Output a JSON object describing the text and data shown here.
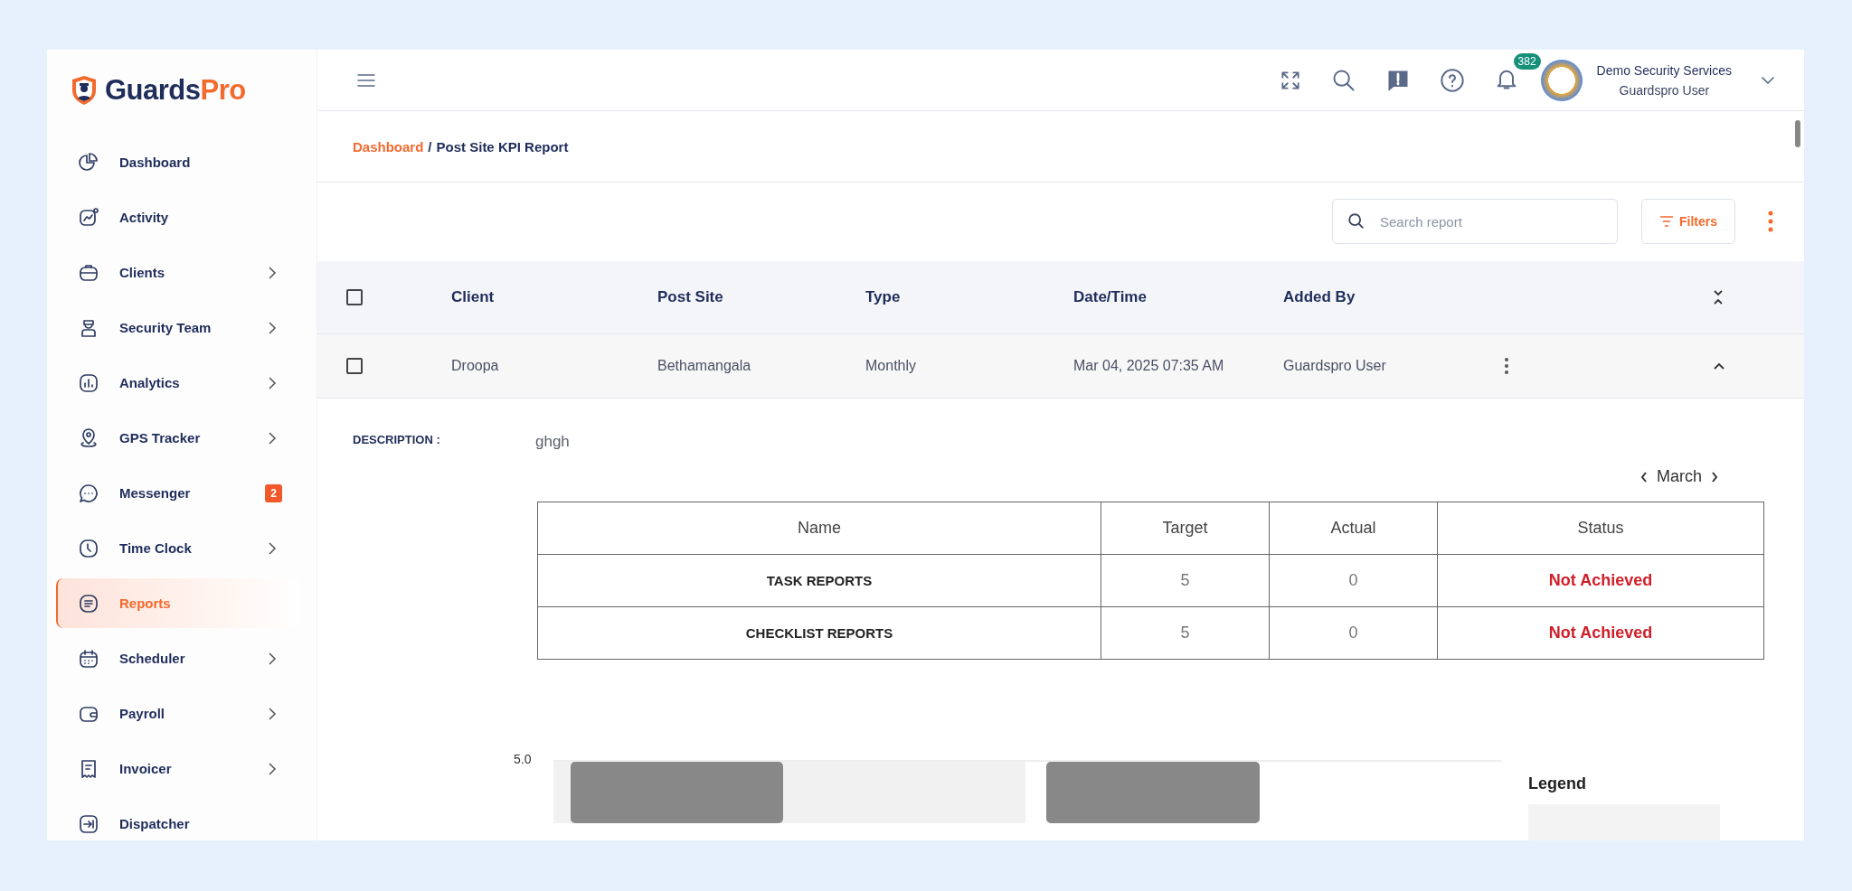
{
  "logo": {
    "text": "Guards",
    "accent_text": "Pro"
  },
  "sidebar": {
    "items": [
      {
        "label": "Dashboard",
        "selected": false,
        "has_submenu": false
      },
      {
        "label": "Activity",
        "selected": false,
        "has_submenu": false
      },
      {
        "label": "Clients",
        "selected": false,
        "has_submenu": true
      },
      {
        "label": "Security Team",
        "selected": false,
        "has_submenu": true
      },
      {
        "label": "Analytics",
        "selected": false,
        "has_submenu": true
      },
      {
        "label": "GPS Tracker",
        "selected": false,
        "has_submenu": true
      },
      {
        "label": "Messenger",
        "selected": false,
        "has_submenu": false,
        "badge": "2"
      },
      {
        "label": "Time Clock",
        "selected": false,
        "has_submenu": true
      },
      {
        "label": "Reports",
        "selected": true,
        "has_submenu": false
      },
      {
        "label": "Scheduler",
        "selected": false,
        "has_submenu": true
      },
      {
        "label": "Payroll",
        "selected": false,
        "has_submenu": true
      },
      {
        "label": "Invoicer",
        "selected": false,
        "has_submenu": true
      },
      {
        "label": "Dispatcher",
        "selected": false,
        "has_submenu": false
      }
    ]
  },
  "topbar": {
    "notification_count": "382",
    "user": {
      "company": "Demo Security Services",
      "name": "Guardspro User"
    }
  },
  "breadcrumb": {
    "link": "Dashboard",
    "separator": "/",
    "current": "Post Site KPI Report"
  },
  "toolbar": {
    "search": {
      "placeholder": "Search report"
    },
    "filters_button": "Filters"
  },
  "table": {
    "header_checked": false,
    "columns": [
      "Client",
      "Post Site",
      "Type",
      "Date/Time",
      "Added By"
    ],
    "rows": [
      {
        "checked": false,
        "expanded": true,
        "cells": [
          "Droopa",
          "Bethamangala",
          "Monthly",
          "Mar 04, 2025 07:35 AM",
          "Guardspro User"
        ]
      }
    ]
  },
  "detail": {
    "description_label": "DESCRIPTION :",
    "description": "ghgh",
    "month": "March",
    "kpi_columns": [
      "Name",
      "Target",
      "Actual",
      "Status"
    ],
    "kpi_rows": [
      {
        "name": "TASK REPORTS",
        "target": "5",
        "actual": "0",
        "status": "Not Achieved",
        "achieved": false
      },
      {
        "name": "CHECKLIST REPORTS",
        "target": "5",
        "actual": "0",
        "status": "Not Achieved",
        "achieved": false
      }
    ],
    "chart": {
      "tick_label": "5.0",
      "legend_title": "Legend"
    }
  }
}
